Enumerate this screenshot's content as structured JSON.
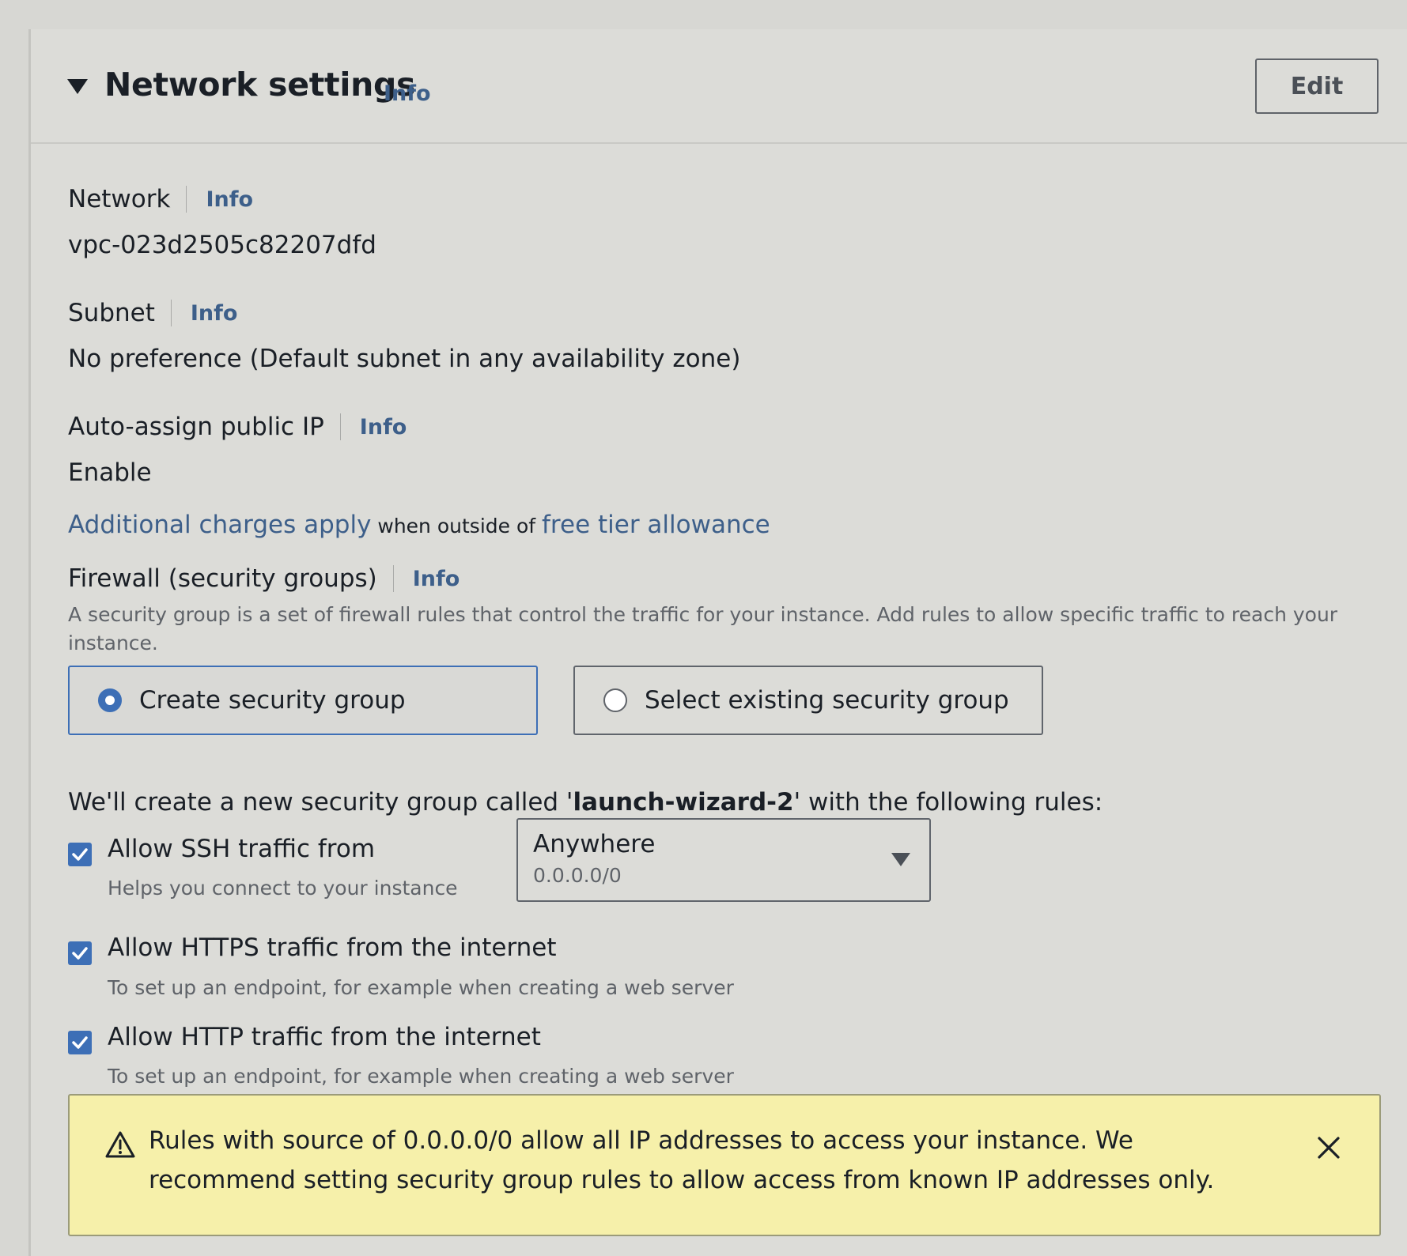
{
  "header": {
    "title": "Network settings",
    "info": "Info",
    "edit_label": "Edit"
  },
  "network": {
    "label": "Network",
    "info": "Info",
    "value": "vpc-023d2505c82207dfd"
  },
  "subnet": {
    "label": "Subnet",
    "info": "Info",
    "value": "No preference (Default subnet in any availability zone)"
  },
  "public_ip": {
    "label": "Auto-assign public IP",
    "info": "Info",
    "value": "Enable"
  },
  "charges": {
    "link1": "Additional charges apply",
    "middle": " when outside of ",
    "link2": "free tier allowance"
  },
  "firewall": {
    "label": "Firewall (security groups)",
    "info": "Info",
    "description": "A security group is a set of firewall rules that control the traffic for your instance. Add rules to allow specific traffic to reach your instance.",
    "options": {
      "create": "Create security group",
      "existing": "Select existing security group"
    },
    "selected": "create",
    "create_prefix": "We'll create a new security group called '",
    "group_name": "launch-wizard-2",
    "create_suffix": "' with the following rules:"
  },
  "rules": {
    "ssh": {
      "label": "Allow SSH traffic from",
      "description": "Helps you connect to your instance",
      "checked": true,
      "source": "Anywhere",
      "source_cidr": "0.0.0.0/0"
    },
    "https": {
      "label": "Allow HTTPS traffic from the internet",
      "description": "To set up an endpoint, for example when creating a web server",
      "checked": true
    },
    "http": {
      "label": "Allow HTTP traffic from the internet",
      "description": "To set up an endpoint, for example when creating a web server",
      "checked": true
    }
  },
  "warning": {
    "text": "Rules with source of 0.0.0.0/0 allow all IP addresses to access your instance. We recommend setting security group rules to allow access from known IP addresses only."
  },
  "colors": {
    "accent": "#3d6fb6",
    "link": "#3d5f8a",
    "warning_bg": "#f6f0aa"
  },
  "icons": {
    "collapse": "caret-down-icon",
    "checkbox": "checkmark-icon",
    "warning": "warning-triangle-icon",
    "close": "close-icon",
    "dropdown": "chevron-down-icon"
  }
}
